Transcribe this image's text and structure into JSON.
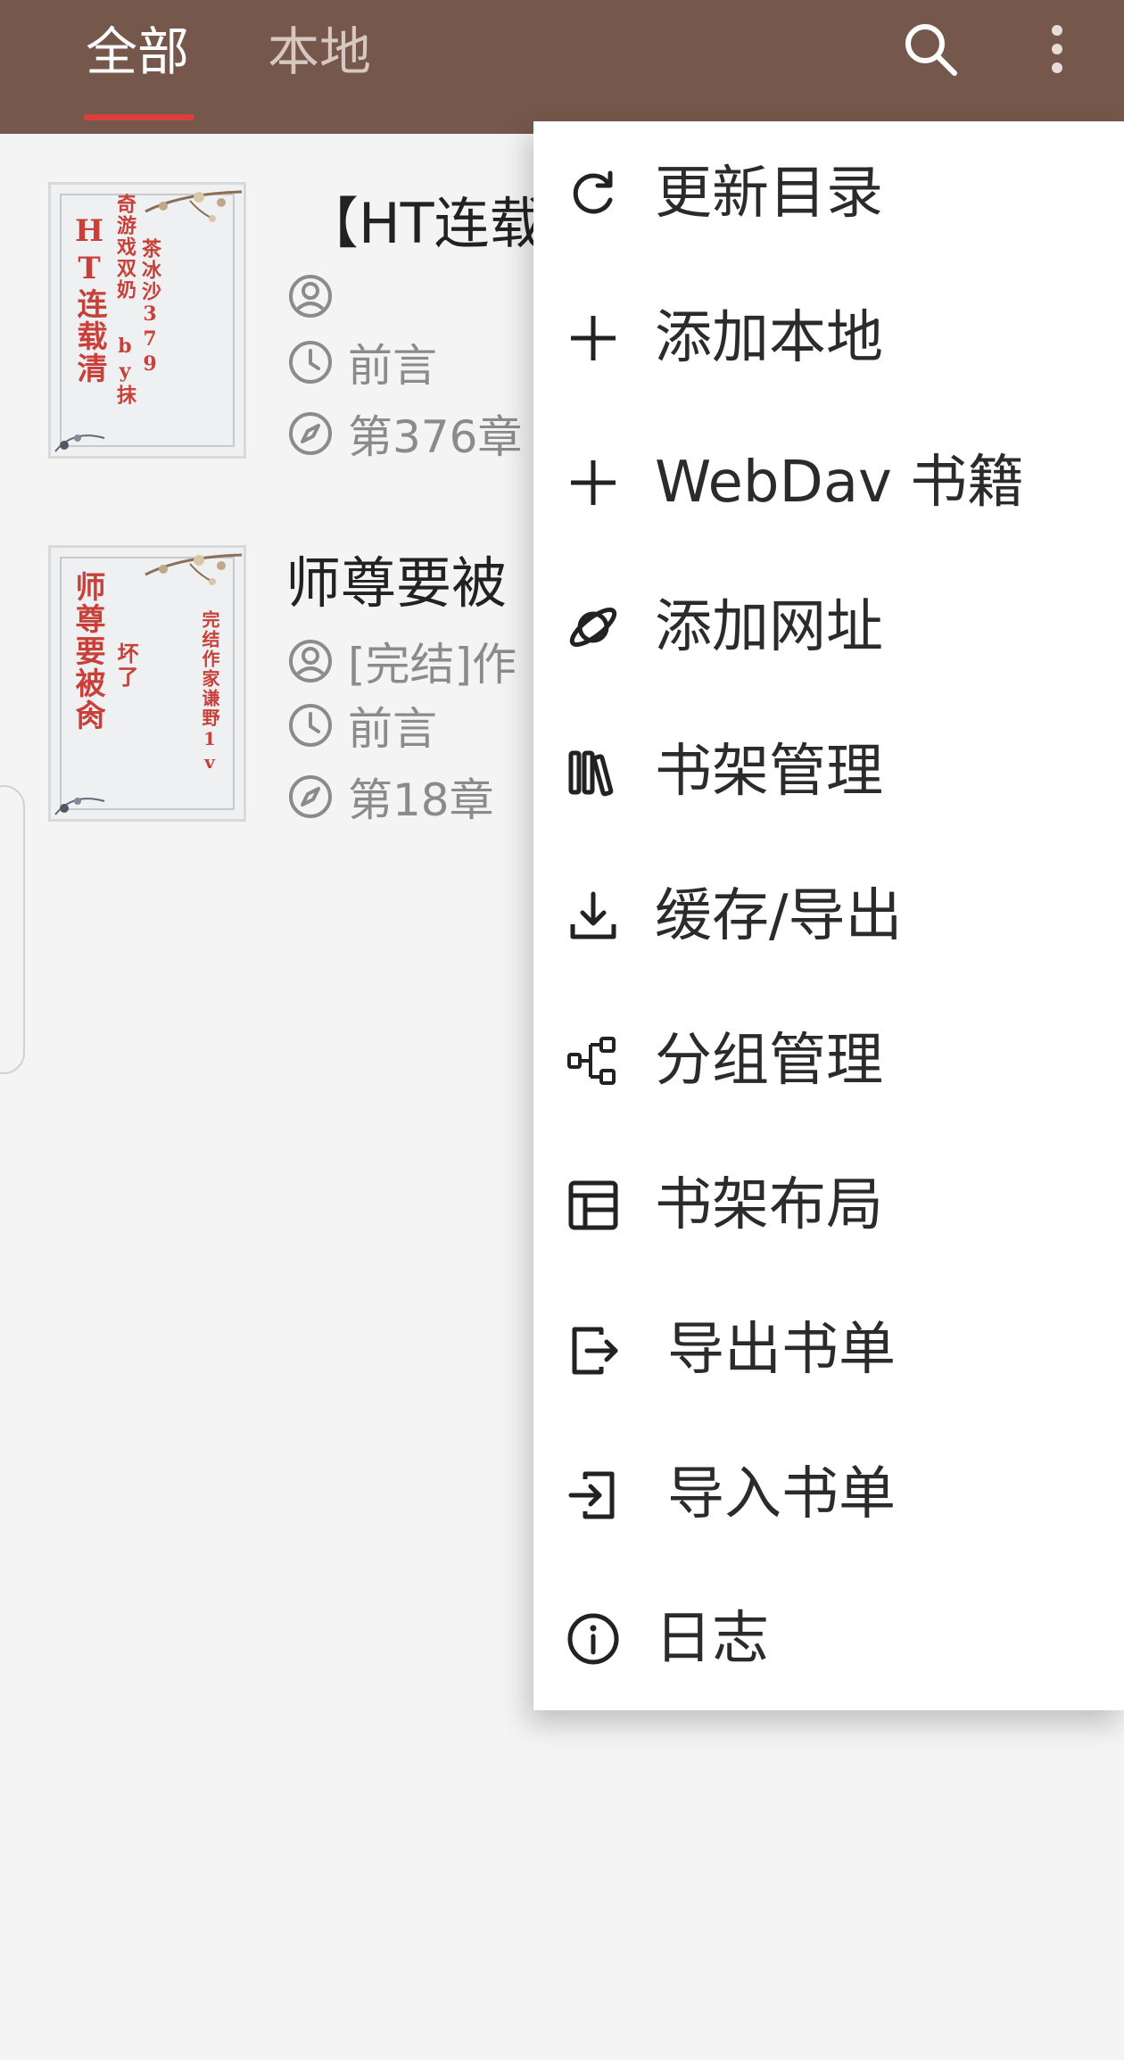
{
  "header": {
    "tabs": [
      {
        "label": "全部",
        "selected": true
      },
      {
        "label": "本地",
        "selected": false
      }
    ],
    "icons": [
      "search-icon",
      "more-vert-icon"
    ],
    "background_color": "#76574b",
    "indicator_color": "#d9413f"
  },
  "books": [
    {
      "title": "【HT连载",
      "author": "",
      "read_progress": "前言",
      "latest_chapter": "第376章",
      "cover_text": {
        "main": "HT连载清",
        "col2": "奇游戏双奶",
        "col3": "茶冰沙379",
        "col4": "by抹"
      }
    },
    {
      "title": "师尊要被",
      "author": "[完结]作",
      "read_progress": "前言",
      "latest_chapter": "第18章 ",
      "cover_text": {
        "main": "师尊要被肏",
        "col2": "坏了",
        "col3": "完结作家谦野1v"
      }
    }
  ],
  "menu": {
    "items": [
      {
        "label": "更新目录",
        "icon": "refresh-icon"
      },
      {
        "label": "添加本地",
        "icon": "plus-icon"
      },
      {
        "label": "WebDav 书籍",
        "icon": "plus-icon"
      },
      {
        "label": "添加网址",
        "icon": "planet-icon"
      },
      {
        "label": "书架管理",
        "icon": "bookshelf-icon"
      },
      {
        "label": "缓存/导出",
        "icon": "download-icon"
      },
      {
        "label": "分组管理",
        "icon": "group-icon"
      },
      {
        "label": "书架布局",
        "icon": "layout-icon"
      },
      {
        "label": "导出书单",
        "icon": "export-icon"
      },
      {
        "label": "导入书单",
        "icon": "import-icon"
      },
      {
        "label": "日志",
        "icon": "info-icon"
      }
    ]
  }
}
